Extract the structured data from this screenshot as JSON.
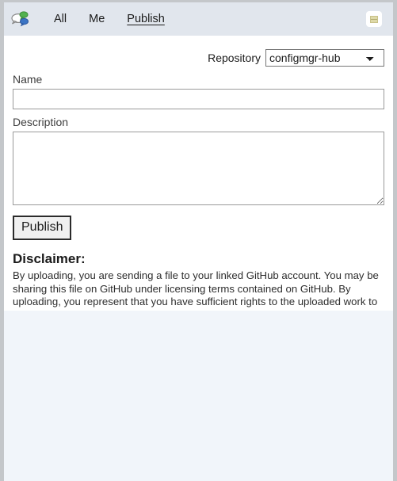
{
  "header": {
    "app_icon": "chat-bubbles-icon",
    "nav": [
      {
        "label": "All",
        "active": false
      },
      {
        "label": "Me",
        "active": false
      },
      {
        "label": "Publish",
        "active": true
      }
    ],
    "action_button_icon": "note-card-icon"
  },
  "form": {
    "repository_label": "Repository",
    "repository_selected": "configmgr-hub",
    "repository_options": [
      "configmgr-hub"
    ],
    "name_label": "Name",
    "name_value": "",
    "name_placeholder": "",
    "description_label": "Description",
    "description_value": "",
    "description_placeholder": "",
    "publish_button": "Publish"
  },
  "disclaimer": {
    "title": "Disclaimer:",
    "body": "By uploading, you are sending a file to your linked GitHub account. You may be sharing this file on GitHub under licensing terms contained on GitHub. By uploading, you represent that you have sufficient rights to the uploaded work to send this file to GitHub and, if applicable, share it under license terms contained on GitHub."
  },
  "colors": {
    "header_bg": "#e1e6ed",
    "panel_bg": "#ffffff",
    "bottom_bg": "#f1f5fa",
    "frame": "#c4c7ca",
    "text": "#1b1b1b"
  }
}
